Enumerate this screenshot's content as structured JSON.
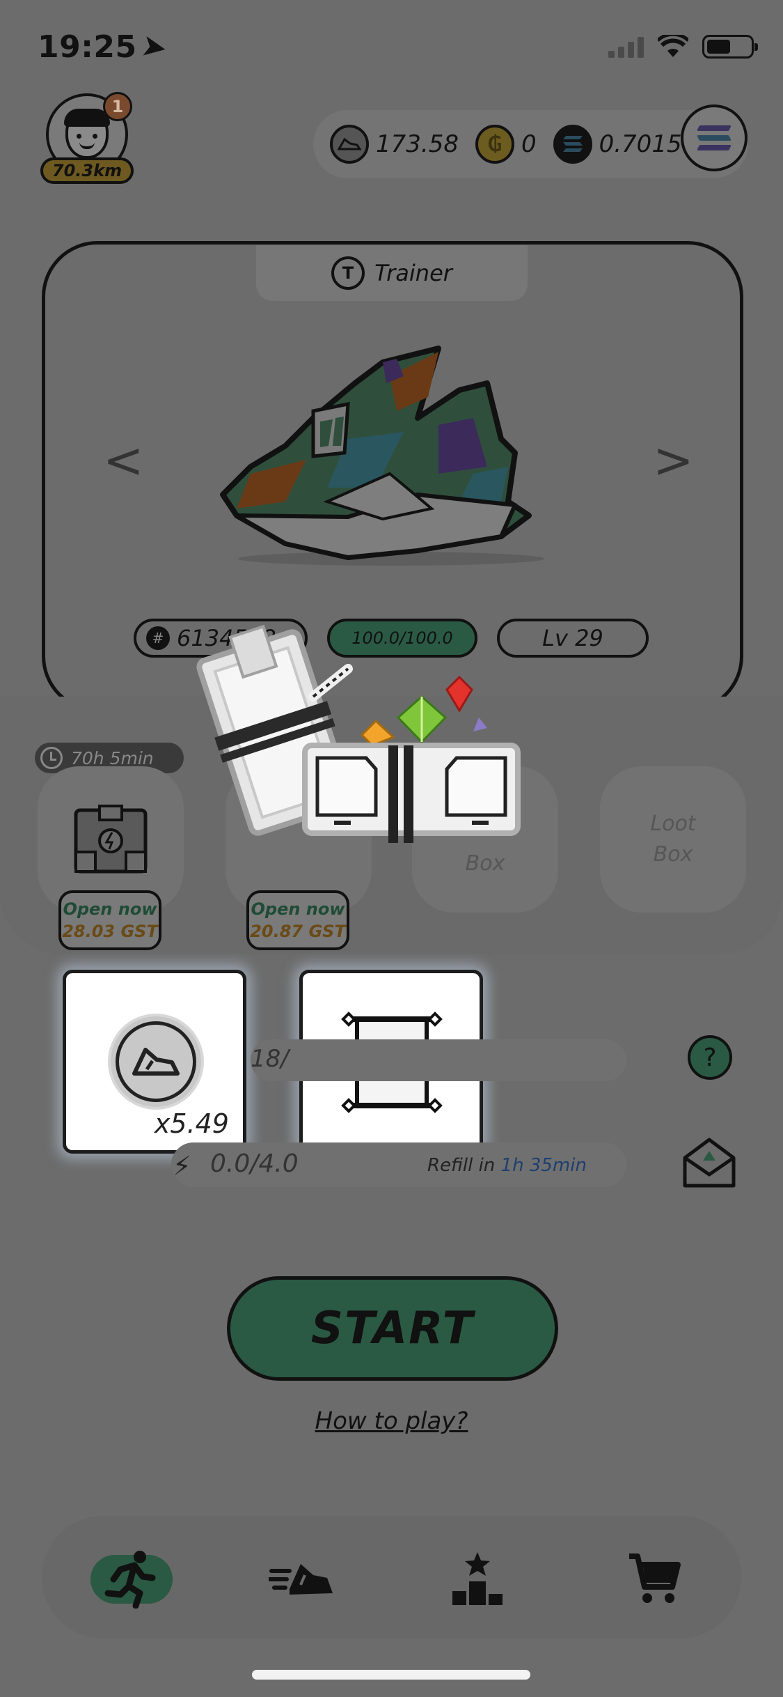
{
  "status_bar": {
    "time": "19:25"
  },
  "profile": {
    "notification_count": "1",
    "distance": "70.3km"
  },
  "wallet": {
    "gst_balance": "173.58",
    "gmt_balance": "0",
    "sol_balance": "0.7015",
    "gmt_symbol": "₲"
  },
  "sneaker": {
    "type": "Trainer",
    "type_icon_letter": "T",
    "id_prefix": "#",
    "id": "6134588",
    "durability": "100.0/100.0",
    "level": "Lv 29",
    "prev_label": "<",
    "next_label": ">"
  },
  "mystery_boxes": {
    "timer": "70h 5min",
    "slots": [
      {
        "label": ""
      },
      {
        "label": ""
      },
      {
        "label": "Box"
      },
      {
        "label": "Loot Box"
      }
    ],
    "open_buttons": [
      {
        "label": "Open now",
        "cost": "28.03 GST"
      },
      {
        "label": "Open now",
        "cost": "20.87 GST"
      }
    ]
  },
  "rewards": {
    "gst_multiplier": "x5.49"
  },
  "energy": {
    "partial_fraction": "18/",
    "help_label": "?",
    "value": "0.0/4.0",
    "refill_label": "Refill in",
    "refill_time": "1h 35min"
  },
  "actions": {
    "start_label": "START",
    "how_to_play": "How to play?"
  },
  "nav": {
    "items": [
      "run-icon",
      "sneaker-icon",
      "leaderboard-icon",
      "cart-icon"
    ]
  },
  "colors": {
    "overlay": "#6c6c6c",
    "accent_green": "#2a5a44",
    "gst_orange": "#6a4a16",
    "link_blue": "#1f3f6e"
  }
}
